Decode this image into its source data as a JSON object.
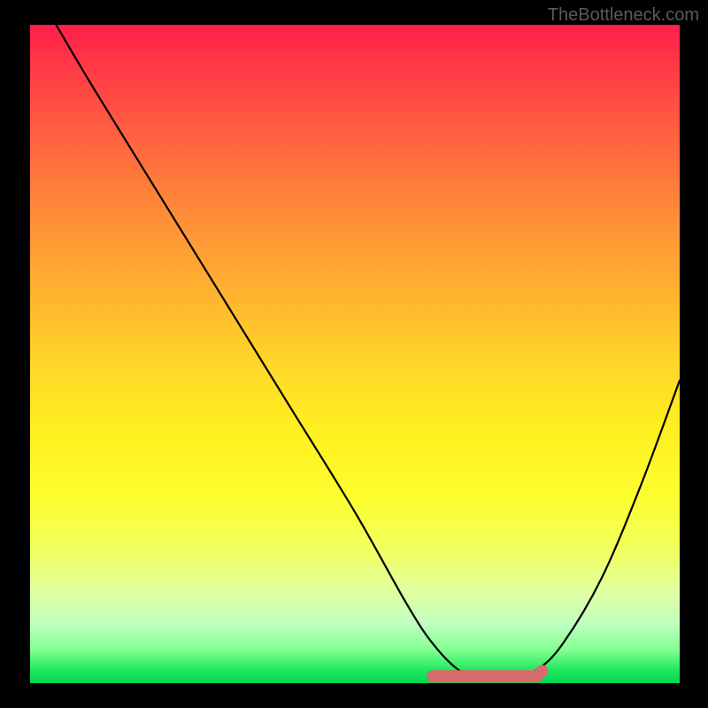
{
  "watermark": "TheBottleneck.com",
  "chart_data": {
    "type": "line",
    "title": "",
    "xlabel": "",
    "ylabel": "",
    "xlim": [
      0,
      100
    ],
    "ylim": [
      0,
      100
    ],
    "series": [
      {
        "name": "bottleneck-curve",
        "x": [
          4,
          10,
          20,
          30,
          40,
          50,
          58,
          62,
          66,
          70,
          74,
          78,
          82,
          88,
          94,
          100
        ],
        "y": [
          100,
          90,
          74,
          58,
          42,
          26,
          12,
          6,
          2,
          0.5,
          0.5,
          2,
          6,
          16,
          30,
          46
        ]
      }
    ],
    "markers": {
      "name": "highlight-range",
      "color": "#d86b6b",
      "x_range": [
        62,
        78
      ],
      "y": 0.5
    },
    "gradient_stops": [
      {
        "pos": 0,
        "color": "#ff1e4a"
      },
      {
        "pos": 50,
        "color": "#ffd828"
      },
      {
        "pos": 100,
        "color": "#00d850"
      }
    ]
  }
}
